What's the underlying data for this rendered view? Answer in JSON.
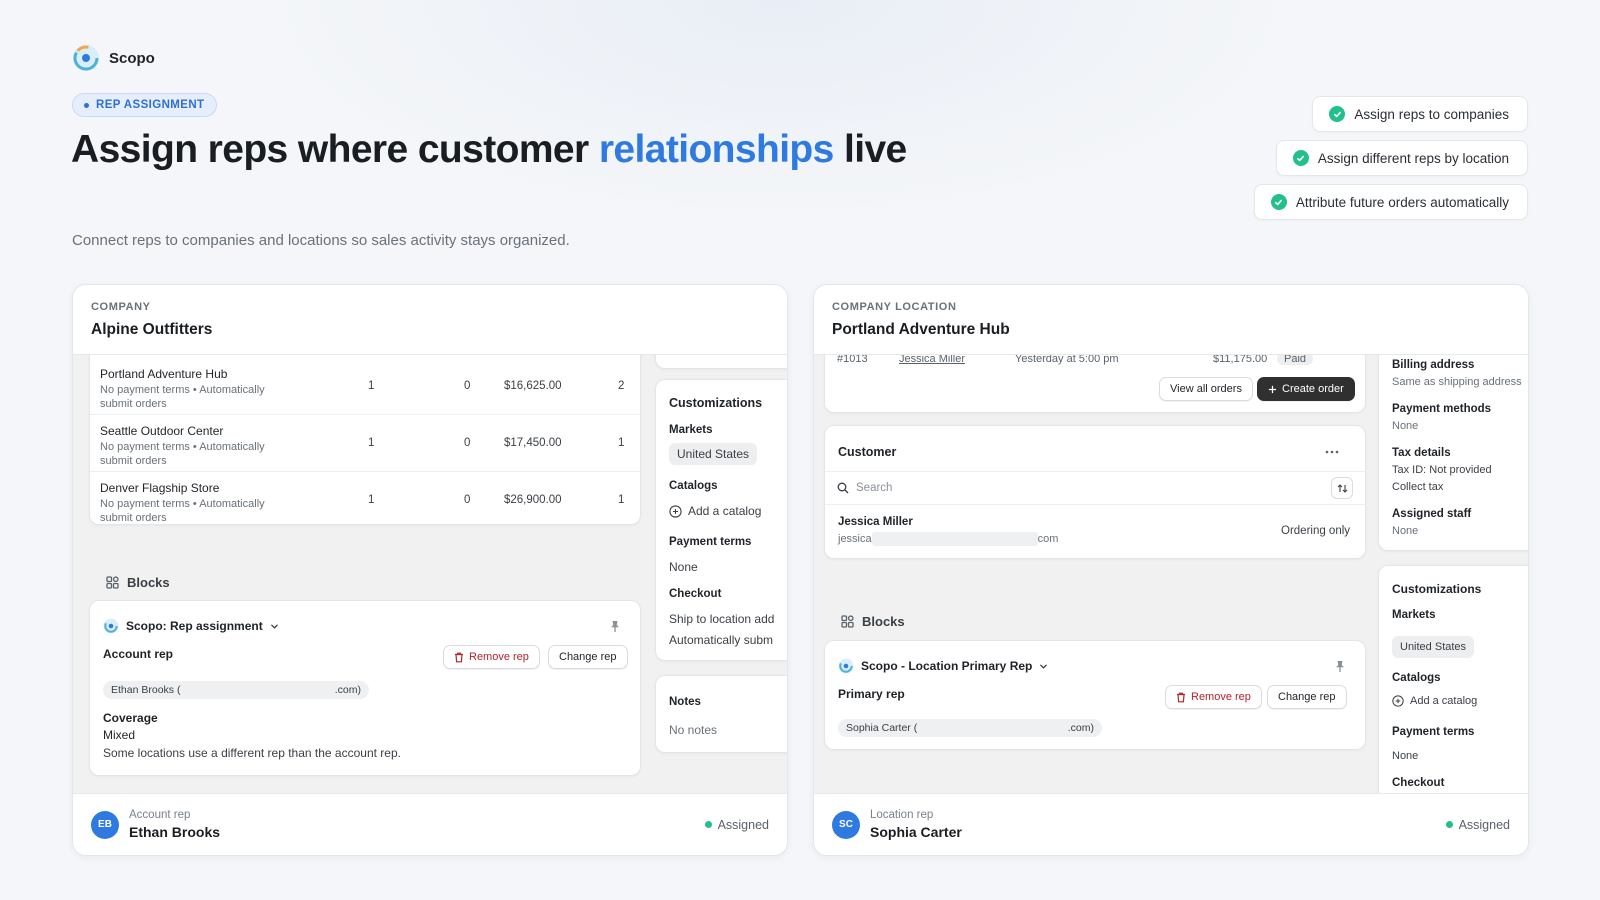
{
  "brand": {
    "name": "Scopo"
  },
  "hero": {
    "pill": "REP ASSIGNMENT",
    "headline_before": "Assign reps where customer ",
    "headline_accent": "relationships",
    "headline_after": " live",
    "subline": "Connect reps to companies and locations so sales activity stays organized."
  },
  "features": [
    "Assign reps to companies",
    "Assign different reps by location",
    "Attribute future orders automatically"
  ],
  "company_card": {
    "eyebrow": "COMPANY",
    "title": "Alpine Outfitters",
    "locations": [
      {
        "name": "Portland Adventure Hub",
        "sub": "No payment terms • Automatically submit orders",
        "c1": "1",
        "c2": "0",
        "amount": "$16,625.00",
        "c4": "2"
      },
      {
        "name": "Seattle Outdoor Center",
        "sub": "No payment terms • Automatically submit orders",
        "c1": "1",
        "c2": "0",
        "amount": "$17,450.00",
        "c4": "1"
      },
      {
        "name": "Denver Flagship Store",
        "sub": "No payment terms • Automatically submit orders",
        "c1": "1",
        "c2": "0",
        "amount": "$26,900.00",
        "c4": "1"
      }
    ],
    "blocks_label": "Blocks",
    "app_block": {
      "app_name": "Scopo: Rep assignment",
      "section": "Account rep",
      "remove_label": "Remove rep",
      "change_label": "Change rep",
      "rep_chip_name": "Ethan Brooks (",
      "rep_chip_suffix": ".com)",
      "coverage_label": "Coverage",
      "coverage_value": "Mixed",
      "coverage_note": "Some locations use a different rep than the account rep."
    },
    "side": {
      "customizations": "Customizations",
      "markets_label": "Markets",
      "market": "United States",
      "catalogs_label": "Catalogs",
      "add_catalog": "Add a catalog",
      "payment_terms_label": "Payment terms",
      "payment_terms_value": "None",
      "checkout_label": "Checkout",
      "checkout_1": "Ship to location add",
      "checkout_2": "Automatically subm",
      "notes_label": "Notes",
      "notes_value": "No notes"
    },
    "footer": {
      "initials": "EB",
      "label": "Account rep",
      "name": "Ethan Brooks",
      "status": "Assigned"
    }
  },
  "location_card": {
    "eyebrow": "COMPANY LOCATION",
    "title": "Portland Adventure Hub",
    "order_partial": {
      "id": "#1013",
      "customer": "Jessica Miller",
      "date": "Yesterday at 5:00 pm",
      "total": "$11,175.00",
      "status": "Paid"
    },
    "view_all": "View all orders",
    "create_order": "Create order",
    "customer": {
      "title": "Customer",
      "search_placeholder": "Search",
      "name": "Jessica Miller",
      "email_prefix": "jessica",
      "email_suffix": "com",
      "role": "Ordering only"
    },
    "blocks_label": "Blocks",
    "app_block": {
      "app_name": "Scopo - Location Primary Rep",
      "section": "Primary rep",
      "remove_label": "Remove rep",
      "change_label": "Change rep",
      "rep_chip_name": "Sophia Carter (",
      "rep_chip_suffix": ".com)"
    },
    "side": {
      "billing_label": "Billing address",
      "billing_value": "Same as shipping address",
      "payment_methods_label": "Payment methods",
      "payment_methods_value": "None",
      "tax_label": "Tax details",
      "tax_id": "Tax ID: Not provided",
      "tax_collect": "Collect tax",
      "staff_label": "Assigned staff",
      "staff_value": "None",
      "customizations": "Customizations",
      "markets_label": "Markets",
      "market": "United States",
      "catalogs_label": "Catalogs",
      "add_catalog": "Add a catalog",
      "payment_terms_label": "Payment terms",
      "payment_terms_value": "None",
      "checkout_label": "Checkout"
    },
    "footer": {
      "initials": "SC",
      "label": "Location rep",
      "name": "Sophia Carter",
      "status": "Assigned"
    }
  },
  "colors": {
    "accent": "#2f7ae0",
    "success": "#22c08a",
    "danger": "#b4232c",
    "dark_button": "#303030"
  },
  "icons": [
    "scopo-logo-icon",
    "check-circle-icon",
    "blocks-icon",
    "pin-icon",
    "trash-icon",
    "chevron-down-icon",
    "plus-icon",
    "plus-circle-icon",
    "search-icon",
    "sort-icon",
    "more-icon"
  ]
}
